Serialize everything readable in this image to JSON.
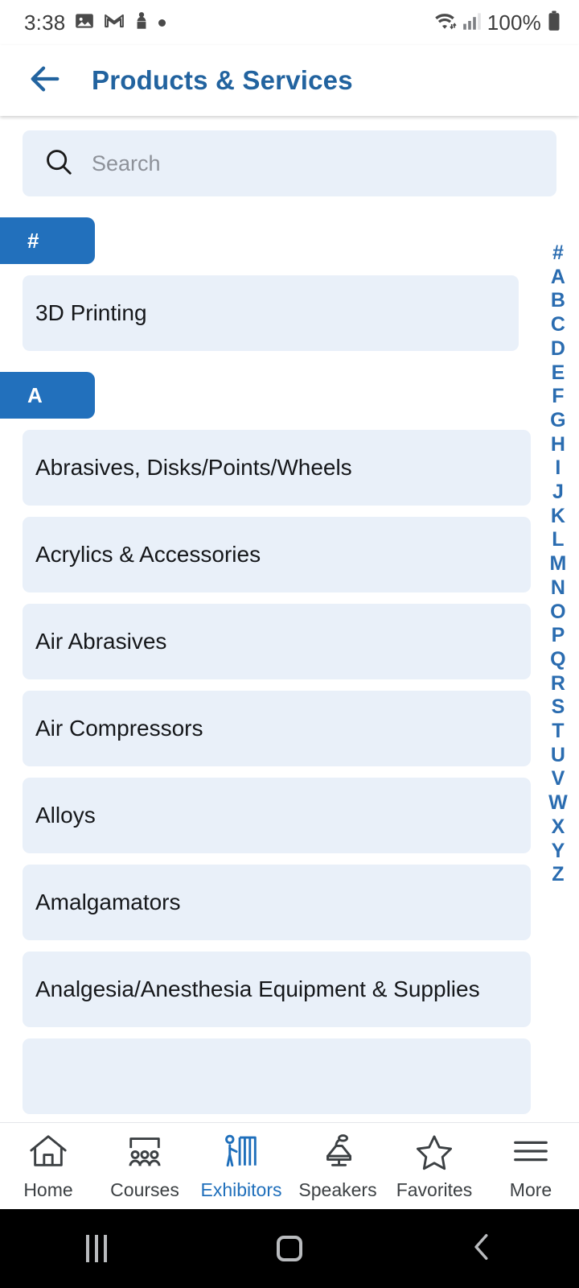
{
  "status_bar": {
    "time": "3:38",
    "battery_percent": "100%",
    "icons": [
      "photos-icon",
      "gmail-icon",
      "person-icon",
      "dot-icon",
      "wifi-icon",
      "cellular-signal-icon",
      "battery-icon"
    ]
  },
  "app_bar": {
    "back_icon": "arrow-left-icon",
    "title": "Products & Services"
  },
  "search": {
    "icon": "search-icon",
    "placeholder": "Search",
    "value": ""
  },
  "sections": [
    {
      "letter": "#",
      "items": [
        "3D Printing"
      ]
    },
    {
      "letter": "A",
      "items": [
        "Abrasives, Disks/Points/Wheels",
        "Acrylics & Accessories",
        "Air Abrasives",
        "Air Compressors",
        "Alloys",
        "Amalgamators",
        "Analgesia/Anesthesia Equipment & Supplies",
        ""
      ]
    }
  ],
  "alpha_index": [
    "#",
    "A",
    "B",
    "C",
    "D",
    "E",
    "F",
    "G",
    "H",
    "I",
    "J",
    "K",
    "L",
    "M",
    "N",
    "O",
    "P",
    "Q",
    "R",
    "S",
    "T",
    "U",
    "V",
    "W",
    "X",
    "Y",
    "Z"
  ],
  "bottom_nav": {
    "active": "Exhibitors",
    "items": [
      {
        "label": "Home",
        "icon": "home-icon"
      },
      {
        "label": "Courses",
        "icon": "classroom-icon"
      },
      {
        "label": "Exhibitors",
        "icon": "exhibitor-booth-icon"
      },
      {
        "label": "Speakers",
        "icon": "podium-icon"
      },
      {
        "label": "Favorites",
        "icon": "star-icon"
      },
      {
        "label": "More",
        "icon": "hamburger-icon"
      }
    ]
  },
  "android_nav": {
    "recents_icon": "recents-icon",
    "home_icon": "home-circle-icon",
    "back_icon": "back-chevron-icon"
  },
  "colors": {
    "brand_blue": "#2270bc",
    "title_blue": "#22639f",
    "card_bg": "#e9f0f9",
    "text_dark": "#15171a",
    "placeholder": "#8d9199"
  }
}
